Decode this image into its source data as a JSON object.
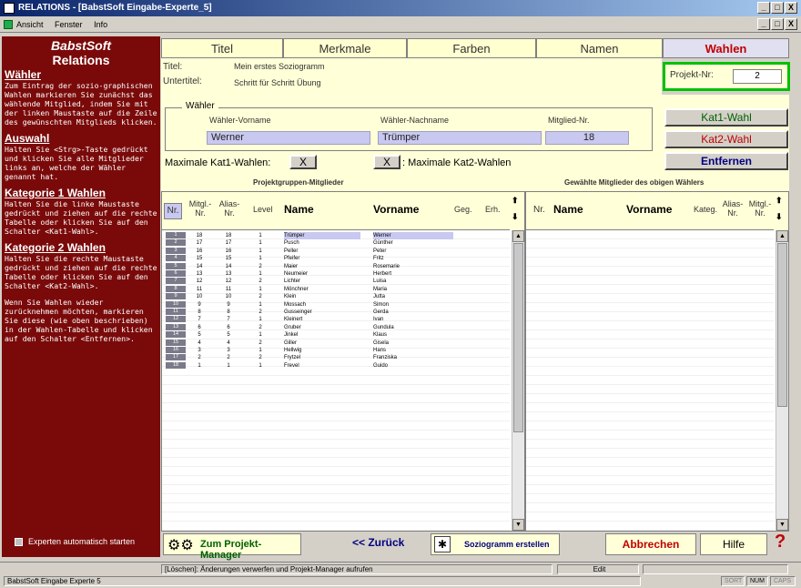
{
  "window": {
    "title": "RELATIONS - [BabstSoft Eingabe-Experte_5]",
    "controls": [
      "_",
      "□",
      "X"
    ]
  },
  "menu": [
    "Ansicht",
    "Fenster",
    "Info"
  ],
  "sidebar": {
    "brand": "BabstSoft",
    "brand2": "Relations",
    "sections": [
      {
        "heading": "Wähler",
        "text": "Zum Eintrag der sozio-graphischen Wahlen markieren Sie zunächst das wählende Mitglied, indem Sie mit der linken Maustaste auf die Zeile des gewünschten Mitglieds klicken."
      },
      {
        "heading": "Auswahl",
        "text": "Halten Sie <Strg>-Taste gedrückt und klicken Sie alle Mitglieder links an, welche der Wähler genannt hat."
      },
      {
        "heading": "Kategorie 1 Wahlen",
        "text": "Halten Sie die linke Maustaste gedrückt und ziehen auf die rechte Tabelle oder klicken Sie auf den Schalter <Kat1-Wahl>."
      },
      {
        "heading": "Kategorie 2 Wahlen",
        "text": "Halten Sie die rechte Maustaste gedrückt und ziehen auf die rechte Tabelle oder klicken Sie auf den Schalter <Kat2-Wahl>."
      },
      {
        "heading": "",
        "text": "Wenn Sie Wahlen wieder zurücknehmen möchten, markieren Sie diese (wie oben beschrieben) in der Wahlen-Tabelle und klicken auf den Schalter <Entfernen>."
      }
    ],
    "checkbox_label": "Experten automatisch starten"
  },
  "tabs": [
    "Titel",
    "Merkmale",
    "Farben",
    "Namen",
    "Wahlen"
  ],
  "title_info": {
    "titel_label": "Titel:",
    "titel_value": "Mein erstes Soziogramm",
    "untertitel_label": "Untertitel:",
    "untertitel_value": "Schritt für Schritt Übung"
  },
  "projekt": {
    "label": "Projekt-Nr:",
    "value": "2"
  },
  "waehler": {
    "legend": "Wähler",
    "vorname_label": "Wähler-Vorname",
    "vorname": "Werner",
    "nachname_label": "Wähler-Nachname",
    "nachname": "Trümper",
    "nr_label": "Mitglied-Nr.",
    "nr": "18"
  },
  "buttons": {
    "kat1": "Kat1-Wahl",
    "kat2": "Kat2-Wahl",
    "entfernen": "Entfernen"
  },
  "max": {
    "kat1_label": "Maximale Kat1-Wahlen:",
    "kat1_value": "X",
    "kat2_value": "X",
    "kat2_label": ": Maximale Kat2-Wahlen"
  },
  "left_table": {
    "caption": "Projektgruppen-Mitglieder",
    "headers": [
      "Nr.",
      "Mitgl.-Nr.",
      "Alias-Nr.",
      "Level",
      "Name",
      "Vorname",
      "Geg.",
      "Erh."
    ],
    "rows": [
      [
        "1",
        "18",
        "18",
        "1",
        "Trümper",
        "Werner"
      ],
      [
        "2",
        "17",
        "17",
        "1",
        "Pusch",
        "Günther"
      ],
      [
        "3",
        "16",
        "16",
        "1",
        "Peller",
        "Peter"
      ],
      [
        "4",
        "15",
        "15",
        "1",
        "Pfeifer",
        "Fritz"
      ],
      [
        "5",
        "14",
        "14",
        "2",
        "Maier",
        "Rosemarie"
      ],
      [
        "6",
        "13",
        "13",
        "1",
        "Neumeier",
        "Herbert"
      ],
      [
        "7",
        "12",
        "12",
        "2",
        "Lichter",
        "Luisa"
      ],
      [
        "8",
        "11",
        "11",
        "1",
        "Mönchner",
        "Maria"
      ],
      [
        "9",
        "10",
        "10",
        "2",
        "Klein",
        "Jutta"
      ],
      [
        "10",
        "9",
        "9",
        "1",
        "Mossach",
        "Simon"
      ],
      [
        "11",
        "8",
        "8",
        "2",
        "Gusseinger",
        "Gerda"
      ],
      [
        "12",
        "7",
        "7",
        "1",
        "Kleinert",
        "Ivan"
      ],
      [
        "13",
        "6",
        "6",
        "2",
        "Gruber",
        "Gundula"
      ],
      [
        "14",
        "5",
        "5",
        "1",
        "Jinkel",
        "Klaus"
      ],
      [
        "15",
        "4",
        "4",
        "2",
        "Giller",
        "Gisela"
      ],
      [
        "16",
        "3",
        "3",
        "1",
        "Hellwig",
        "Hans"
      ],
      [
        "17",
        "2",
        "2",
        "2",
        "Frytzel",
        "Franziska"
      ],
      [
        "18",
        "1",
        "1",
        "1",
        "Frevel",
        "Guido"
      ]
    ]
  },
  "right_table": {
    "caption": "Gewählte Mitglieder des obigen Wählers",
    "headers": [
      "Nr.",
      "Name",
      "Vorname",
      "Kateg.",
      "Alias-Nr.",
      "Mitgl.-Nr."
    ]
  },
  "bottom": {
    "projekt_manager": "Zum Projekt-Manager",
    "zurueck": "<< Zurück",
    "soziogramm": "Soziogramm erstellen",
    "abbrechen": "Abbrechen",
    "hilfe": "Hilfe",
    "help_icon": "?"
  },
  "status": {
    "hint": "[Löschen]: Änderungen verwerfen und Projekt-Manager aufrufen",
    "mode": "Edit",
    "doc": "BabstSoft Eingabe Experte 5",
    "num": "NUM",
    "sort": "SORT",
    "caps": "CAPS"
  }
}
